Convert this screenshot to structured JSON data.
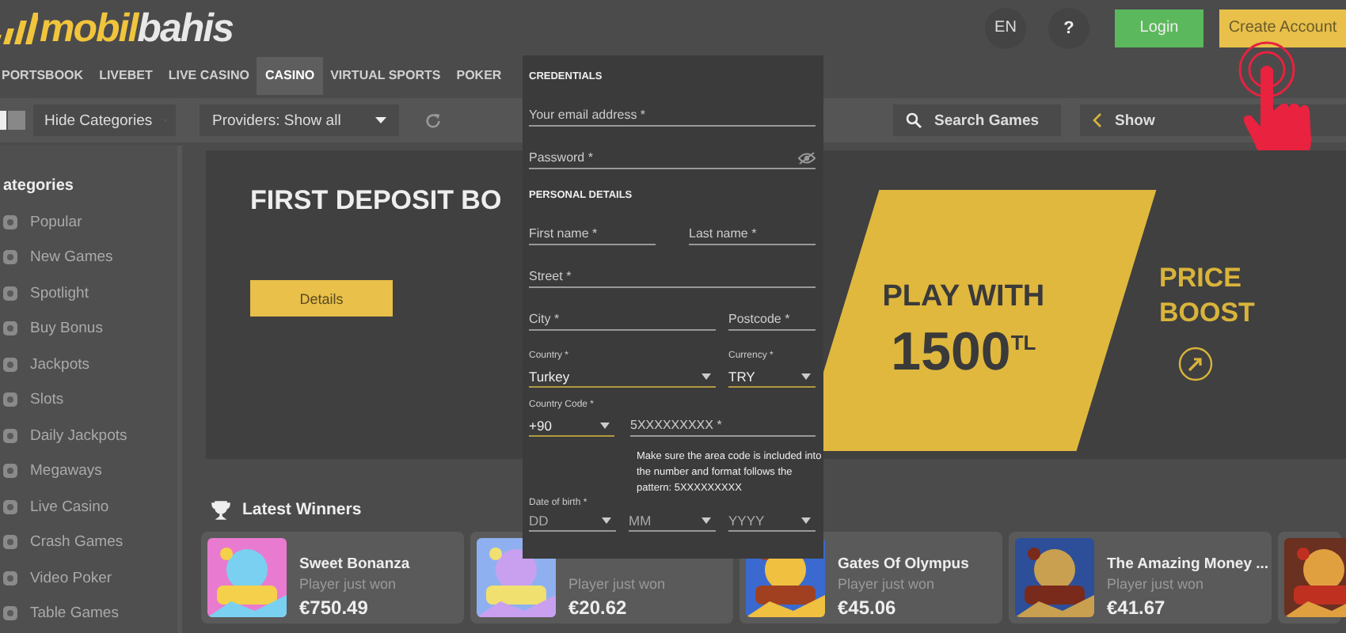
{
  "header": {
    "logo": {
      "primary": "mobil",
      "secondary": "bahis"
    },
    "language": "EN",
    "help": "?",
    "buttons": [
      {
        "label": "Login",
        "kind": "login"
      },
      {
        "label": "Create Account",
        "kind": "register"
      }
    ]
  },
  "nav": [
    {
      "label": "PORTSBOOK",
      "selected": false
    },
    {
      "label": "LIVEBET",
      "selected": false
    },
    {
      "label": "LIVE CASINO",
      "selected": false
    },
    {
      "label": "CASINO",
      "selected": true
    },
    {
      "label": "VIRTUAL SPORTS",
      "selected": false
    },
    {
      "label": "POKER",
      "selected": false
    }
  ],
  "toolbar": {
    "hide_categories": "Hide Categories",
    "providers": "Providers: Show all",
    "search": "Search Games",
    "show": "Show"
  },
  "sidebar": {
    "title": "ategories",
    "items": [
      "Popular",
      "New Games",
      "Spotlight",
      "Buy Bonus",
      "Jackpots",
      "Slots",
      "Daily Jackpots",
      "Megaways",
      "Live Casino",
      "Crash Games",
      "Video Poker",
      "Table Games"
    ]
  },
  "banner": {
    "title": "FIRST DEPOSIT BO",
    "button": "Details",
    "promo_line1": "PLAY WITH",
    "promo_amount": "1500$^{TL}$",
    "side_line1": "PRICE",
    "side_line2": "BOOST"
  },
  "modal": {
    "credentials_title": "CREDENTIALS",
    "email": "Your email address *",
    "password": "Password *",
    "personal_title": "PERSONAL DETAILS",
    "first_name": "First name *",
    "last_name": "Last name *",
    "street": "Street *",
    "city": "City *",
    "postcode": "Postcode *",
    "country": {
      "label": "Country *",
      "value": "Turkey"
    },
    "currency": {
      "label": "Currency *",
      "value": "TRY"
    },
    "country_code": {
      "label": "Country Code *",
      "value": "+90"
    },
    "phone": "5XXXXXXXXX *",
    "hint": "Make sure the area code is included into the number and format follows the pattern: 5XXXXXXXXX",
    "dob": {
      "label": "Date of birth *",
      "fields": [
        "DD",
        "MM",
        "YYYY"
      ]
    }
  },
  "latest_winners": {
    "title": "Latest Winners",
    "cards": [
      {
        "kind": "game",
        "title": "Sweet Bonanza",
        "subtitle": "Player just won",
        "amount": "€750.49"
      },
      {
        "kind": "game",
        "subtitle": "Player just won",
        "amount": "€20.62"
      },
      {
        "kind": "game",
        "title": "Gates Of Olympus",
        "subtitle": "Player just won",
        "amount": "€45.06"
      },
      {
        "kind": "game",
        "title": "The Amazing Money ...",
        "subtitle": "Player just won",
        "amount": "€41.67"
      },
      {
        "kind": "partial"
      }
    ]
  }
}
